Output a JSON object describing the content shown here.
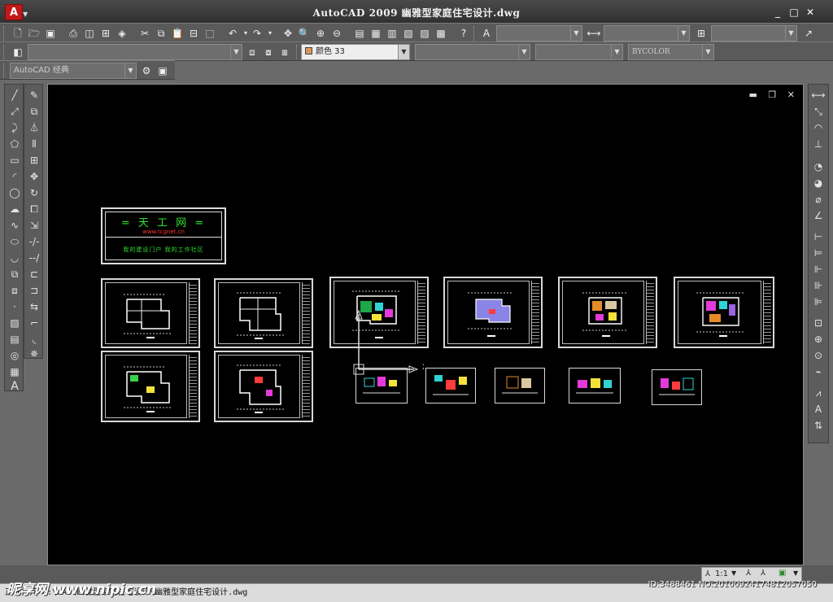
{
  "window": {
    "title": "AutoCAD 2009  幽雅型家庭住宅设计.dwg",
    "app_icon": "A",
    "minimize": "_",
    "maximize": "□",
    "close": "✕"
  },
  "toolbar_top": {
    "icons": [
      "new-icon",
      "open-icon",
      "save-icon",
      "print-icon",
      "preview-icon",
      "publish-icon",
      "plot-icon",
      "3d-dwf-icon",
      "cut-icon",
      "copy-icon",
      "paste-icon",
      "match-icon",
      "block-icon",
      "undo-icon",
      "redo-icon",
      "pan-icon",
      "zoom-realtime-icon",
      "zoom-window-icon",
      "zoom-previous-icon",
      "properties-icon",
      "design-center-icon",
      "tool-palettes-icon",
      "sheet-set-icon",
      "markup-icon",
      "quickcalc-icon",
      "help-icon"
    ]
  },
  "toolbar_style": {
    "text_style": "",
    "dim_style": "",
    "table_style": "",
    "multileader_style": ""
  },
  "toolbar_layers": {
    "layer_value": "",
    "color_value": "颜色 33",
    "linetype_value": "",
    "lineweight_value": "",
    "plotstyle_value": "BYCOLOR"
  },
  "workspace": {
    "value": "AutoCAD 经典"
  },
  "drawing": {
    "window_controls": [
      "▬",
      "❐",
      "✕"
    ],
    "tiangong": {
      "title": "= 天 工 网 =",
      "url": "www.tcgnet.cn",
      "tagline": "我的建设门户  我的工作社区"
    }
  },
  "status": {
    "scale": "1:1",
    "command_line": "正在打开 F:\\CAD\\幽雅型家庭住宅设计\\幽雅型家庭住宅设计.dwg"
  },
  "overlay": {
    "watermark": "昵享网 www.nipic.cn",
    "id_stamp": "ID:3488461 NO:20100924174812057050"
  },
  "colors": {
    "accent_green": "#2fe12f",
    "accent_red": "#ff3030",
    "canvas_bg": "#000000"
  }
}
